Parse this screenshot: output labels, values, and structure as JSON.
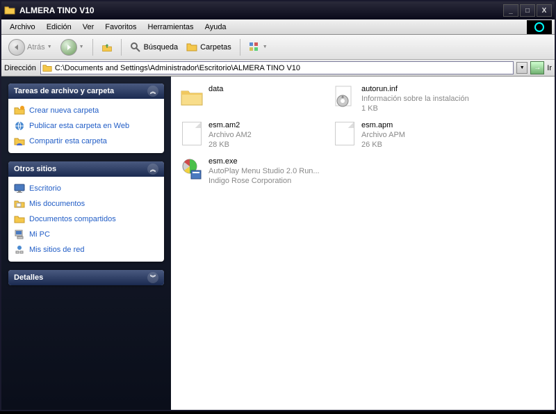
{
  "title": "ALMERA TINO V10",
  "window_buttons": {
    "min": "_",
    "max": "□",
    "close": "X"
  },
  "menubar": [
    "Archivo",
    "Edición",
    "Ver",
    "Favoritos",
    "Herramientas",
    "Ayuda"
  ],
  "toolbar": {
    "back": "Atrás",
    "search": "Búsqueda",
    "folders": "Carpetas"
  },
  "address": {
    "label": "Dirección",
    "value": "C:\\Documents and Settings\\Administrador\\Escritorio\\ALMERA TINO V10",
    "go": "Ir"
  },
  "sidebar": {
    "tasks": {
      "title": "Tareas de archivo y carpeta",
      "items": [
        {
          "icon": "folder-new-icon",
          "label": "Crear nueva carpeta"
        },
        {
          "icon": "publish-web-icon",
          "label": "Publicar esta carpeta en Web"
        },
        {
          "icon": "share-folder-icon",
          "label": "Compartir esta carpeta"
        }
      ]
    },
    "places": {
      "title": "Otros sitios",
      "items": [
        {
          "icon": "desktop-icon",
          "label": "Escritorio"
        },
        {
          "icon": "documents-icon",
          "label": "Mis documentos"
        },
        {
          "icon": "shared-docs-icon",
          "label": "Documentos compartidos"
        },
        {
          "icon": "mypc-icon",
          "label": "Mi PC"
        },
        {
          "icon": "network-icon",
          "label": "Mis sitios de red"
        }
      ]
    },
    "details": {
      "title": "Detalles"
    }
  },
  "files": [
    {
      "icon": "folder",
      "name": "data",
      "desc": "",
      "size": ""
    },
    {
      "icon": "inf",
      "name": "autorun.inf",
      "desc": "Información sobre la instalación",
      "size": "1 KB"
    },
    {
      "icon": "file",
      "name": "esm.am2",
      "desc": "Archivo AM2",
      "size": "28 KB"
    },
    {
      "icon": "file",
      "name": "esm.apm",
      "desc": "Archivo APM",
      "size": "26 KB"
    },
    {
      "icon": "exe",
      "name": "esm.exe",
      "desc": "AutoPlay Menu Studio 2.0 Run...",
      "size": "Indigo Rose Corporation"
    }
  ]
}
